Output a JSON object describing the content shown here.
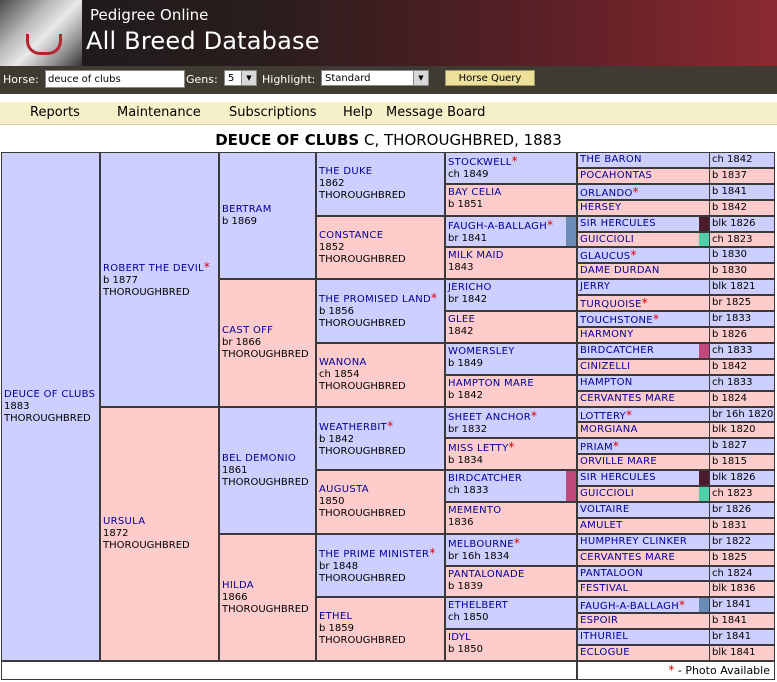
{
  "header": {
    "site_name": "Pedigree Online",
    "database_title": "All Breed Database"
  },
  "toolbar": {
    "horse_label": "Horse:",
    "horse_value": "deuce of clubs",
    "gens_label": "Gens:",
    "gens_value": "5",
    "highlight_label": "Highlight:",
    "highlight_value": "Standard",
    "query_label": "Horse Query"
  },
  "menu": {
    "items": [
      "Reports",
      "Maintenance",
      "Subscriptions",
      "Help",
      "Message Board"
    ]
  },
  "title": {
    "name": "DEUCE OF CLUBS",
    "rest": " C, THOROUGHBRED, 1883"
  },
  "footer": {
    "star": "*",
    "text": " - Photo Available"
  },
  "colors": {
    "male_bg": "#cccfff",
    "female_bg": "#ffcccc",
    "name_color": "#000099",
    "star_color": "#e00000"
  },
  "g0": {
    "name": "DEUCE OF CLUBS",
    "line1": "1883",
    "line2": "THOROUGHBRED",
    "star": false,
    "sex": "m"
  },
  "g1": [
    {
      "name": "ROBERT THE DEVIL",
      "line1": "b 1877",
      "line2": "THOROUGHBRED",
      "star": true,
      "sex": "m"
    },
    {
      "name": "URSULA",
      "line1": "1872",
      "line2": "THOROUGHBRED",
      "star": false,
      "sex": "f"
    }
  ],
  "g2": [
    {
      "name": "BERTRAM",
      "line1": "b 1869",
      "line2": "",
      "star": false,
      "sex": "m"
    },
    {
      "name": "CAST OFF",
      "line1": "br 1866",
      "line2": "THOROUGHBRED",
      "star": false,
      "sex": "f"
    },
    {
      "name": "BEL DEMONIO",
      "line1": "1861",
      "line2": "THOROUGHBRED",
      "star": false,
      "sex": "m"
    },
    {
      "name": "HILDA",
      "line1": "1866",
      "line2": "THOROUGHBRED",
      "star": false,
      "sex": "f"
    }
  ],
  "g3": [
    {
      "name": "THE DUKE",
      "line1": "1862",
      "line2": "THOROUGHBRED",
      "star": false,
      "sex": "m"
    },
    {
      "name": "CONSTANCE",
      "line1": "1852",
      "line2": "THOROUGHBRED",
      "star": false,
      "sex": "f"
    },
    {
      "name": "THE PROMISED LAND",
      "line1": "b 1856",
      "line2": "THOROUGHBRED",
      "star": true,
      "sex": "m"
    },
    {
      "name": "WANONA",
      "line1": "ch 1854",
      "line2": "THOROUGHBRED",
      "star": false,
      "sex": "f"
    },
    {
      "name": "WEATHERBIT",
      "line1": "b 1842",
      "line2": "THOROUGHBRED",
      "star": true,
      "sex": "m"
    },
    {
      "name": "AUGUSTA",
      "line1": "1850",
      "line2": "THOROUGHBRED",
      "star": false,
      "sex": "f"
    },
    {
      "name": "THE PRIME MINISTER",
      "line1": "br 1848",
      "line2": "THOROUGHBRED",
      "star": true,
      "sex": "m"
    },
    {
      "name": "ETHEL",
      "line1": "b 1859",
      "line2": "THOROUGHBRED",
      "star": false,
      "sex": "f"
    }
  ],
  "g4": [
    {
      "name": "STOCKWELL",
      "line1": "ch 1849",
      "star": true,
      "sex": "m",
      "swatch": ""
    },
    {
      "name": "BAY CELIA",
      "line1": "b 1851",
      "star": false,
      "sex": "f",
      "swatch": ""
    },
    {
      "name": "FAUGH-A-BALLAGH",
      "line1": "br 1841",
      "star": true,
      "sex": "m",
      "swatch": "#6a8ab8"
    },
    {
      "name": "MILK MAID",
      "line1": "1843",
      "star": false,
      "sex": "f",
      "swatch": ""
    },
    {
      "name": "JERICHO",
      "line1": "br 1842",
      "star": false,
      "sex": "m",
      "swatch": ""
    },
    {
      "name": "GLEE",
      "line1": "1842",
      "star": false,
      "sex": "f",
      "swatch": ""
    },
    {
      "name": "WOMERSLEY",
      "line1": "b 1849",
      "star": false,
      "sex": "m",
      "swatch": ""
    },
    {
      "name": "HAMPTON MARE",
      "line1": "b 1842",
      "star": false,
      "sex": "f",
      "swatch": ""
    },
    {
      "name": "SHEET ANCHOR",
      "line1": "br 1832",
      "star": true,
      "sex": "m",
      "swatch": ""
    },
    {
      "name": "MISS LETTY",
      "line1": "b 1834",
      "star": true,
      "sex": "f",
      "swatch": ""
    },
    {
      "name": "BIRDCATCHER",
      "line1": "ch 1833",
      "star": false,
      "sex": "m",
      "swatch": "#c0487a"
    },
    {
      "name": "MEMENTO",
      "line1": "1836",
      "star": false,
      "sex": "f",
      "swatch": ""
    },
    {
      "name": "MELBOURNE",
      "line1": "br 16h 1834",
      "star": true,
      "sex": "m",
      "swatch": ""
    },
    {
      "name": "PANTALONADE",
      "line1": "b 1839",
      "star": false,
      "sex": "f",
      "swatch": ""
    },
    {
      "name": "ETHELBERT",
      "line1": "ch 1850",
      "star": false,
      "sex": "m",
      "swatch": ""
    },
    {
      "name": "IDYL",
      "line1": "b 1850",
      "star": false,
      "sex": "f",
      "swatch": ""
    }
  ],
  "g5": [
    {
      "name": "THE BARON",
      "info": "ch 1842",
      "star": false,
      "sex": "m",
      "swatch": ""
    },
    {
      "name": "POCAHONTAS",
      "info": "b 1837",
      "star": false,
      "sex": "f",
      "swatch": ""
    },
    {
      "name": "ORLANDO",
      "info": "b 1841",
      "star": true,
      "sex": "m",
      "swatch": ""
    },
    {
      "name": "HERSEY",
      "info": "b 1842",
      "star": false,
      "sex": "f",
      "swatch": ""
    },
    {
      "name": "SIR HERCULES",
      "info": "blk 1826",
      "star": false,
      "sex": "m",
      "swatch": "#4a1c2c"
    },
    {
      "name": "GUICCIOLI",
      "info": "ch 1823",
      "star": false,
      "sex": "f",
      "swatch": "#4fd0a8"
    },
    {
      "name": "GLAUCUS",
      "info": "b 1830",
      "star": true,
      "sex": "m",
      "swatch": ""
    },
    {
      "name": "DAME DURDAN",
      "info": "b 1830",
      "star": false,
      "sex": "f",
      "swatch": ""
    },
    {
      "name": "JERRY",
      "info": "blk 1821",
      "star": false,
      "sex": "m",
      "swatch": ""
    },
    {
      "name": "TURQUOISE",
      "info": "br 1825",
      "star": true,
      "sex": "f",
      "swatch": ""
    },
    {
      "name": "TOUCHSTONE",
      "info": "br 1833",
      "star": true,
      "sex": "m",
      "swatch": ""
    },
    {
      "name": "HARMONY",
      "info": "b 1826",
      "star": false,
      "sex": "f",
      "swatch": ""
    },
    {
      "name": "BIRDCATCHER",
      "info": "ch 1833",
      "star": false,
      "sex": "m",
      "swatch": "#c0487a"
    },
    {
      "name": "CINIZELLI",
      "info": "b 1842",
      "star": false,
      "sex": "f",
      "swatch": ""
    },
    {
      "name": "HAMPTON",
      "info": "ch 1833",
      "star": false,
      "sex": "m",
      "swatch": ""
    },
    {
      "name": "CERVANTES MARE",
      "info": "b 1824",
      "star": false,
      "sex": "f",
      "swatch": ""
    },
    {
      "name": "LOTTERY",
      "info": "br 16h 1820",
      "star": true,
      "sex": "m",
      "swatch": ""
    },
    {
      "name": "MORGIANA",
      "info": "blk 1820",
      "star": false,
      "sex": "f",
      "swatch": ""
    },
    {
      "name": "PRIAM",
      "info": "b 1827",
      "star": true,
      "sex": "m",
      "swatch": ""
    },
    {
      "name": "ORVILLE MARE",
      "info": "b 1815",
      "star": false,
      "sex": "f",
      "swatch": ""
    },
    {
      "name": "SIR HERCULES",
      "info": "blk 1826",
      "star": false,
      "sex": "m",
      "swatch": "#4a1c2c"
    },
    {
      "name": "GUICCIOLI",
      "info": "ch 1823",
      "star": false,
      "sex": "f",
      "swatch": "#4fd0a8"
    },
    {
      "name": "VOLTAIRE",
      "info": "br 1826",
      "star": false,
      "sex": "m",
      "swatch": ""
    },
    {
      "name": "AMULET",
      "info": "b 1831",
      "star": false,
      "sex": "f",
      "swatch": ""
    },
    {
      "name": "HUMPHREY CLINKER",
      "info": "br 1822",
      "star": false,
      "sex": "m",
      "swatch": ""
    },
    {
      "name": "CERVANTES MARE",
      "info": "b 1825",
      "star": false,
      "sex": "f",
      "swatch": ""
    },
    {
      "name": "PANTALOON",
      "info": "ch 1824",
      "star": false,
      "sex": "m",
      "swatch": ""
    },
    {
      "name": "FESTIVAL",
      "info": "blk 1836",
      "star": false,
      "sex": "f",
      "swatch": ""
    },
    {
      "name": "FAUGH-A-BALLAGH",
      "info": "br 1841",
      "star": true,
      "sex": "m",
      "swatch": "#6a8ab8"
    },
    {
      "name": "ESPOIR",
      "info": "b 1841",
      "star": false,
      "sex": "f",
      "swatch": ""
    },
    {
      "name": "ITHURIEL",
      "info": "br 1841",
      "star": false,
      "sex": "m",
      "swatch": ""
    },
    {
      "name": "ECLOGUE",
      "info": "blk 1841",
      "star": false,
      "sex": "f",
      "swatch": ""
    }
  ]
}
